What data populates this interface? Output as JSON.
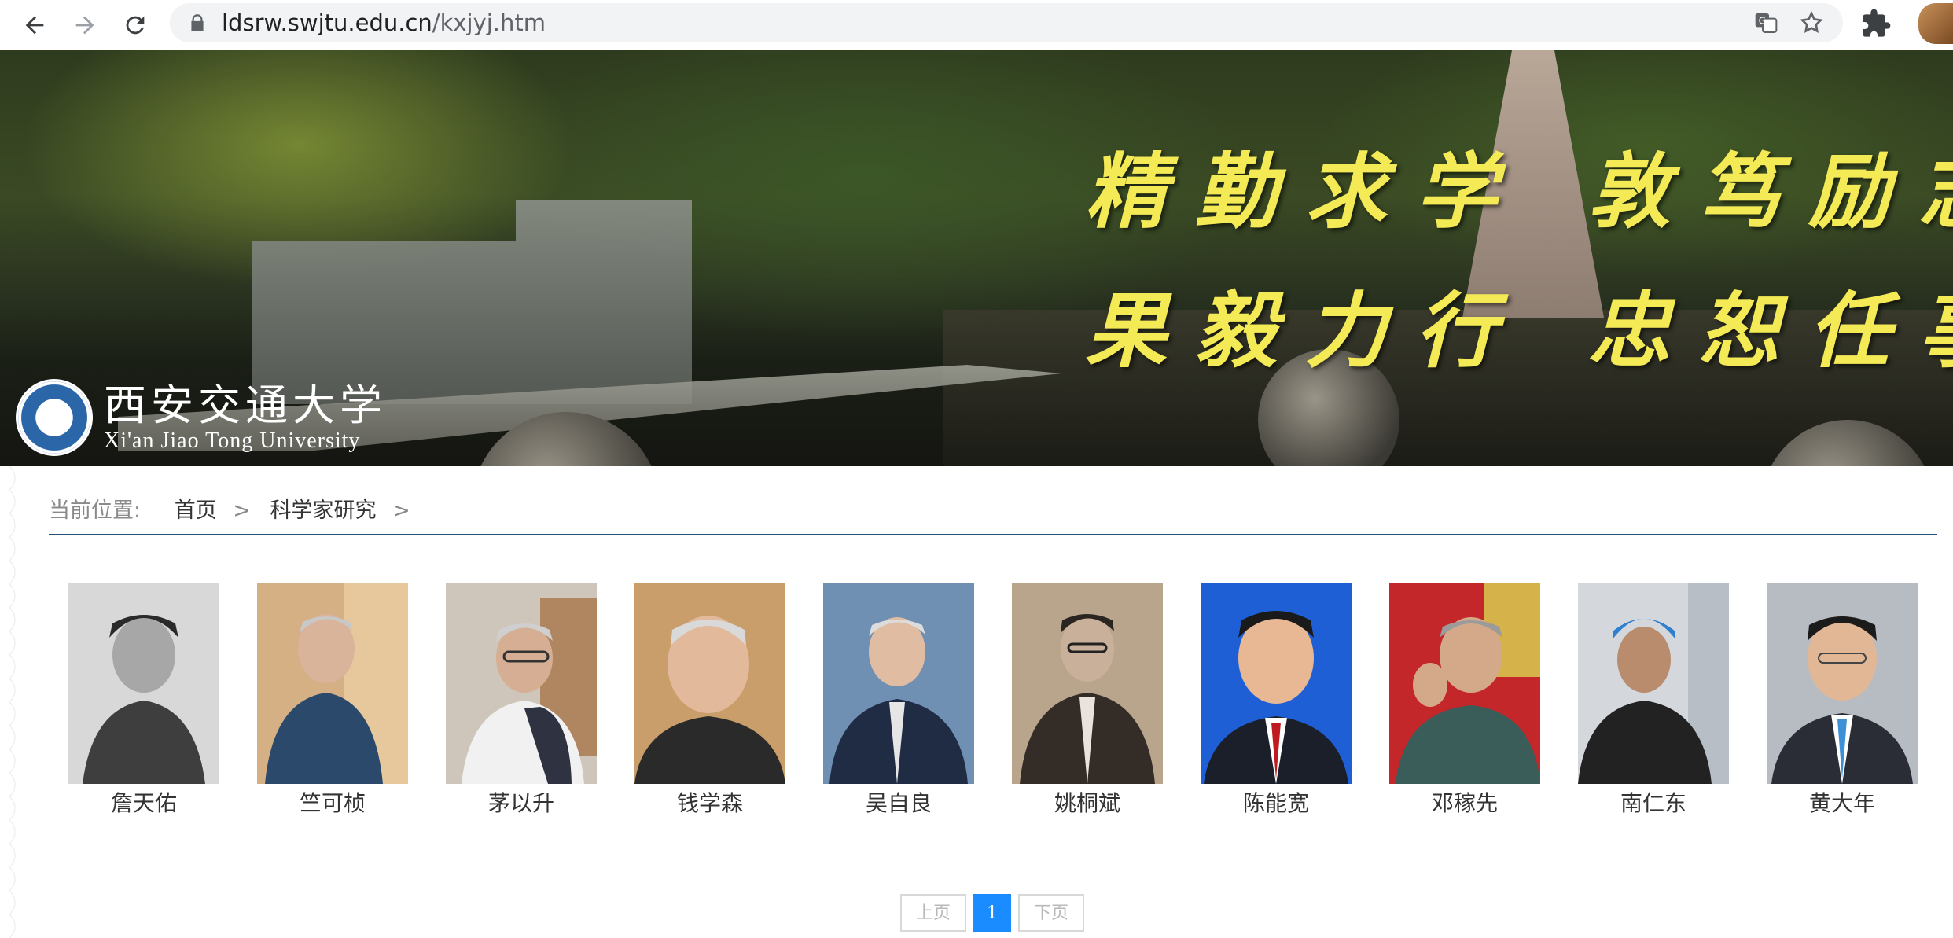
{
  "browser": {
    "url_domain": "ldsrw.swjtu.edu.cn",
    "url_path": "/kxjyj.htm"
  },
  "banner": {
    "motto_line1": [
      "精勤求学",
      "敦笃励志"
    ],
    "motto_line2": [
      "果毅力行",
      "忠恕任事"
    ],
    "logo_cn": "西安交通大学",
    "logo_en": "Xi'an Jiao Tong University"
  },
  "breadcrumb": {
    "label": "当前位置:",
    "home": "首页",
    "separator": ">",
    "current": "科学家研究"
  },
  "scientists": [
    {
      "name": "詹天佑"
    },
    {
      "name": "竺可桢"
    },
    {
      "name": "茅以升"
    },
    {
      "name": "钱学森"
    },
    {
      "name": "吴自良"
    },
    {
      "name": "姚桐斌"
    },
    {
      "name": "陈能宽"
    },
    {
      "name": "邓稼先"
    },
    {
      "name": "南仁东"
    },
    {
      "name": "黄大年"
    }
  ],
  "pagination": {
    "prev": "上页",
    "current": "1",
    "next": "下页"
  },
  "colors": {
    "accent_blue": "#1a8cff",
    "divider": "#264f78",
    "motto": "#f3ea56"
  }
}
